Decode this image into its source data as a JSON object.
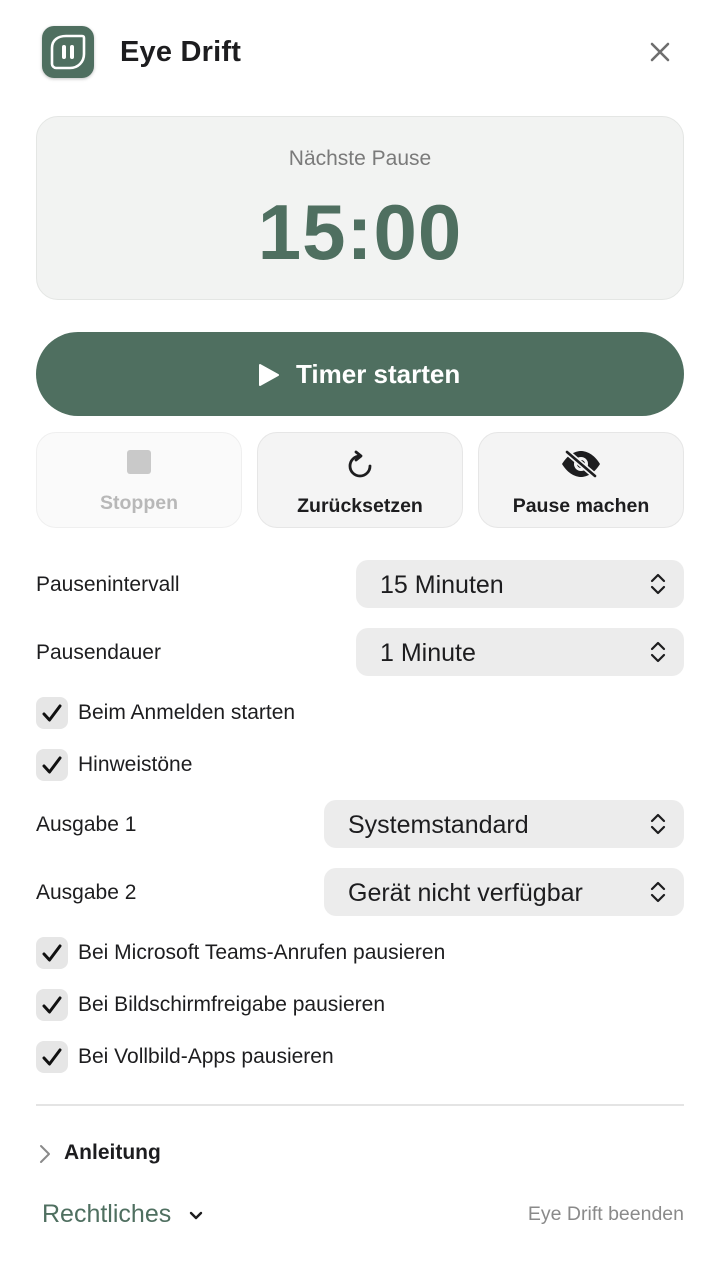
{
  "header": {
    "app_title": "Eye Drift",
    "app_icon": "pause-leaf-icon",
    "close_icon": "close-icon"
  },
  "timer": {
    "label": "Nächste Pause",
    "value": "15:00"
  },
  "primary_action": {
    "label": "Timer starten",
    "icon": "play-icon"
  },
  "actions": [
    {
      "label": "Stoppen",
      "icon": "stop-icon",
      "enabled": false
    },
    {
      "label": "Zurücksetzen",
      "icon": "reset-icon",
      "enabled": true
    },
    {
      "label": "Pause machen",
      "icon": "eye-slash-icon",
      "enabled": true
    }
  ],
  "settings": {
    "interval": {
      "label": "Pausenintervall",
      "value": "15 Minuten"
    },
    "duration": {
      "label": "Pausendauer",
      "value": "1 Minute"
    },
    "login_start": {
      "label": "Beim Anmelden starten",
      "checked": true
    },
    "sounds": {
      "label": "Hinweistöne",
      "checked": true
    },
    "output1": {
      "label": "Ausgabe 1",
      "value": "Systemstandard"
    },
    "output2": {
      "label": "Ausgabe 2",
      "value": "Gerät nicht verfügbar"
    },
    "pause_teams": {
      "label": "Bei Microsoft Teams-Anrufen pausieren",
      "checked": true
    },
    "pause_screenshare": {
      "label": "Bei Bildschirmfreigabe pausieren",
      "checked": true
    },
    "pause_fullscreen": {
      "label": "Bei Vollbild-Apps pausieren",
      "checked": true
    }
  },
  "footer": {
    "guide_label": "Anleitung",
    "legal_label": "Rechtliches",
    "quit_label": "Eye Drift beenden"
  },
  "colors": {
    "accent": "#4f6f60",
    "card_bg": "#f2f3f2",
    "control_bg": "#ececec",
    "muted_text": "#8a8a8a"
  }
}
